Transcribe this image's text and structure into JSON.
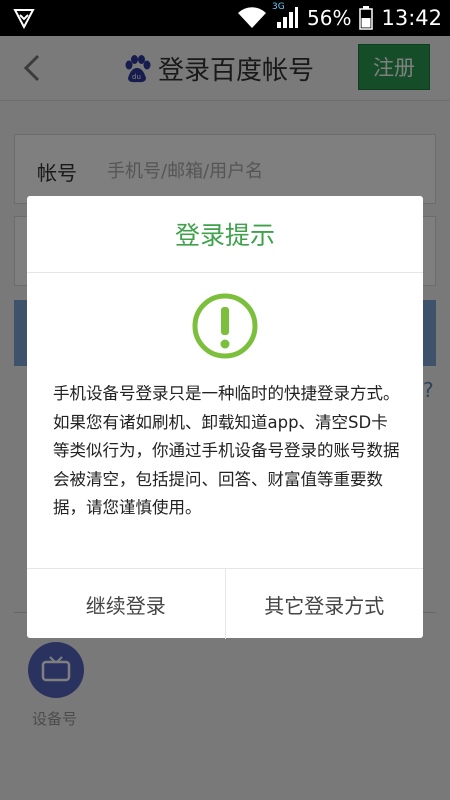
{
  "status_bar": {
    "network": "3G",
    "battery_percent": "56%",
    "time": "13:42",
    "icons": [
      "shield-icon",
      "wifi-icon",
      "signal-icon",
      "battery-icon"
    ]
  },
  "header": {
    "title": "登录百度帐号",
    "register_label": "注册",
    "accent_color": "#2c9b52"
  },
  "form": {
    "account_label": "帐号",
    "account_placeholder": "手机号/邮箱/用户名",
    "help_mark": "?"
  },
  "other_login": {
    "device_label": "设备号"
  },
  "dialog": {
    "title": "登录提示",
    "title_color": "#3fa24a",
    "message": "手机设备号登录只是一种临时的快捷登录方式。如果您有诸如刷机、卸载知道app、清空SD卡等类似行为，你通过手机设备号登录的账号数据会被清空，包括提问、回答、财富值等重要数据，请您谨慎使用。",
    "continue_label": "继续登录",
    "other_label": "其它登录方式"
  }
}
